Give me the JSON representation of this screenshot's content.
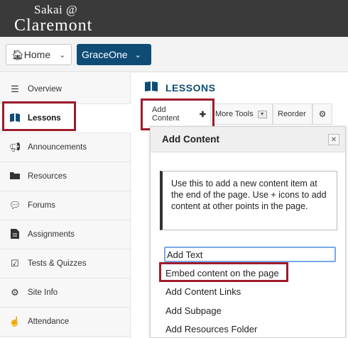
{
  "header": {
    "logo_top": "Sakai @",
    "logo_bottom": "Claremont"
  },
  "sitebar": {
    "home_label": "Home",
    "site_label": "GraceOne"
  },
  "sidebar": {
    "items": [
      {
        "label": "Overview",
        "icon": "list-icon"
      },
      {
        "label": "Lessons",
        "icon": "book-icon"
      },
      {
        "label": "Announcements",
        "icon": "bullhorn-icon"
      },
      {
        "label": "Resources",
        "icon": "folder-icon"
      },
      {
        "label": "Forums",
        "icon": "comments-icon"
      },
      {
        "label": "Assignments",
        "icon": "file-icon"
      },
      {
        "label": "Tests & Quizzes",
        "icon": "checkbox-icon"
      },
      {
        "label": "Site Info",
        "icon": "gear-icon"
      },
      {
        "label": "Attendance",
        "icon": "hand-icon"
      }
    ]
  },
  "main": {
    "title": "LESSONS",
    "toolbar": {
      "add_content": "Add Content",
      "more_tools": "More Tools",
      "reorder": "Reorder"
    },
    "dialog": {
      "title": "Add Content",
      "info": "Use this to add a new content item at the end of the page. Use + icons to add content at other points in the page.",
      "options": [
        "Add Text",
        "Embed content on the page",
        "Add Content Links",
        "Add Subpage",
        "Add Resources Folder"
      ]
    }
  },
  "colors": {
    "header_bg": "#3a3a3a",
    "brand": "#0f4c75",
    "highlight": "#9c1c2c"
  }
}
